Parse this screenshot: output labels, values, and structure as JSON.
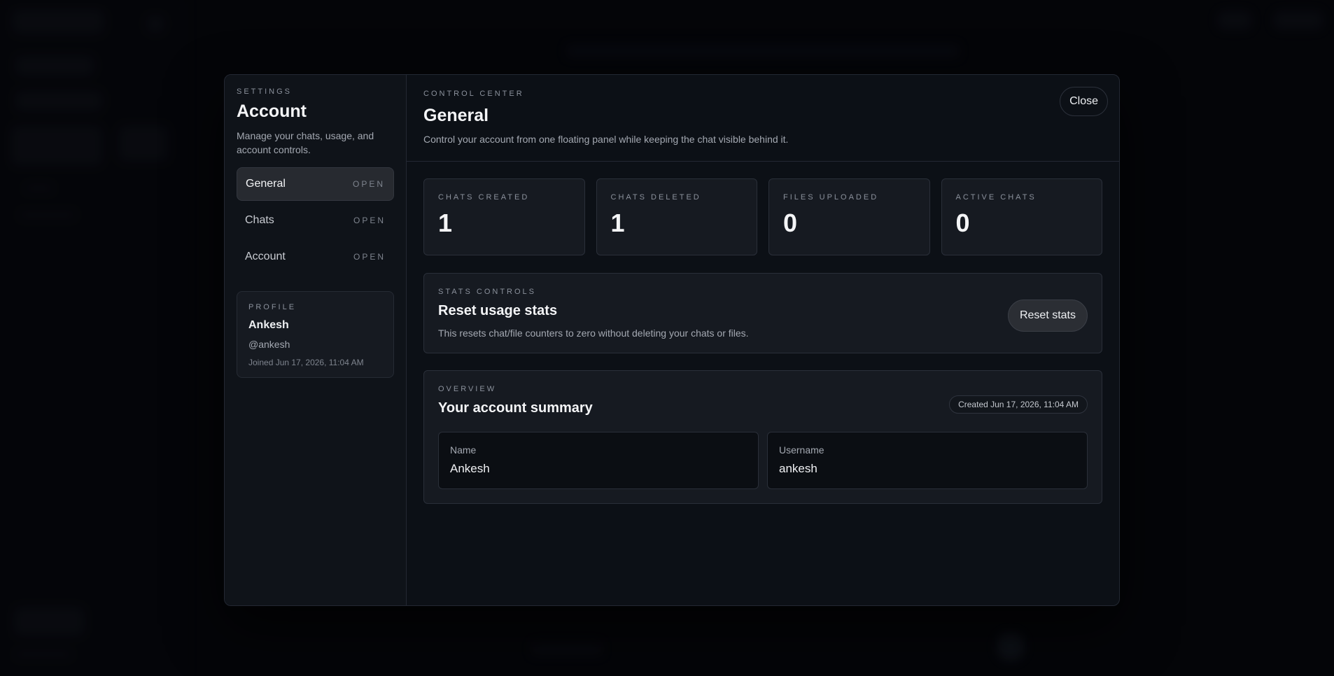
{
  "sidebar": {
    "eyebrow": "SETTINGS",
    "title": "Account",
    "description": "Manage your chats, usage, and account controls.",
    "items": [
      {
        "label": "General",
        "tag": "OPEN"
      },
      {
        "label": "Chats",
        "tag": "OPEN"
      },
      {
        "label": "Account",
        "tag": "OPEN"
      }
    ],
    "profile": {
      "eyebrow": "PROFILE",
      "name": "Ankesh",
      "handle": "@ankesh",
      "joined": "Joined Jun 17, 2026, 11:04 AM"
    }
  },
  "main": {
    "eyebrow": "CONTROL CENTER",
    "title": "General",
    "subtitle": "Control your account from one floating panel while keeping the chat visible behind it.",
    "close_label": "Close",
    "stats": [
      {
        "label": "CHATS CREATED",
        "value": "1"
      },
      {
        "label": "CHATS DELETED",
        "value": "1"
      },
      {
        "label": "FILES UPLOADED",
        "value": "0"
      },
      {
        "label": "ACTIVE CHATS",
        "value": "0"
      }
    ],
    "stats_controls": {
      "eyebrow": "STATS CONTROLS",
      "title": "Reset usage stats",
      "description": "This resets chat/file counters to zero without deleting your chats or files.",
      "button": "Reset stats"
    },
    "overview": {
      "eyebrow": "OVERVIEW",
      "title": "Your account summary",
      "badge": "Created Jun 17, 2026, 11:04 AM",
      "fields": [
        {
          "key": "Name",
          "value": "Ankesh"
        },
        {
          "key": "Username",
          "value": "ankesh"
        }
      ]
    }
  }
}
